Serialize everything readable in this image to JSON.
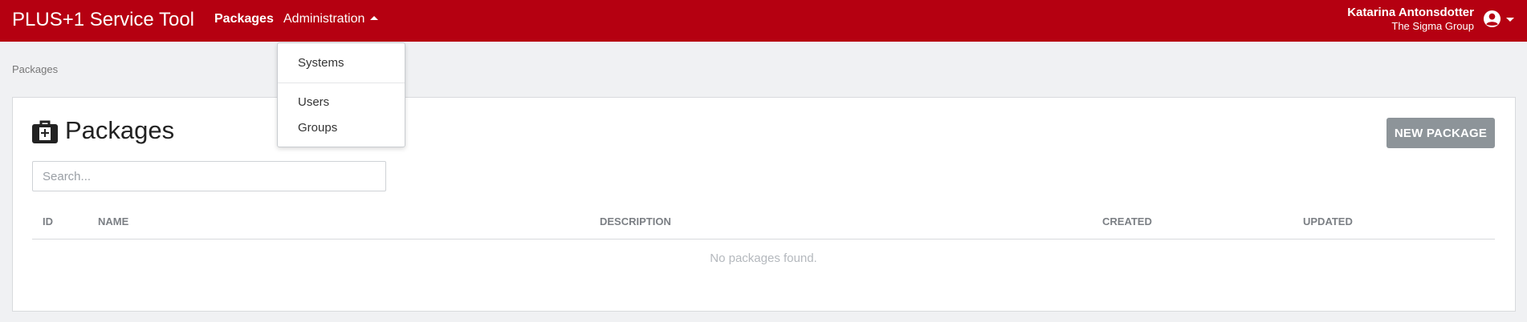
{
  "app": {
    "title": "PLUS+1 Service Tool"
  },
  "nav": {
    "packages_label": "Packages",
    "administration_label": "Administration",
    "administration_menu": {
      "items": [
        {
          "label": "Systems"
        },
        {
          "label": "Users"
        },
        {
          "label": "Groups"
        }
      ]
    }
  },
  "user": {
    "name": "Katarina Antonsdotter",
    "organization": "The Sigma Group",
    "icon": "user-circle-icon"
  },
  "breadcrumb": {
    "current": "Packages"
  },
  "page": {
    "title": "Packages",
    "title_icon": "package-briefcase-icon",
    "new_button_label": "NEW PACKAGE",
    "search_placeholder": "Search...",
    "search_value": ""
  },
  "table": {
    "columns": [
      "ID",
      "NAME",
      "DESCRIPTION",
      "CREATED",
      "UPDATED"
    ],
    "rows": [],
    "empty_message": "No packages found."
  },
  "colors": {
    "navbar": "#b50011",
    "new_button": "#8d9499",
    "background": "#f0f1f3"
  }
}
